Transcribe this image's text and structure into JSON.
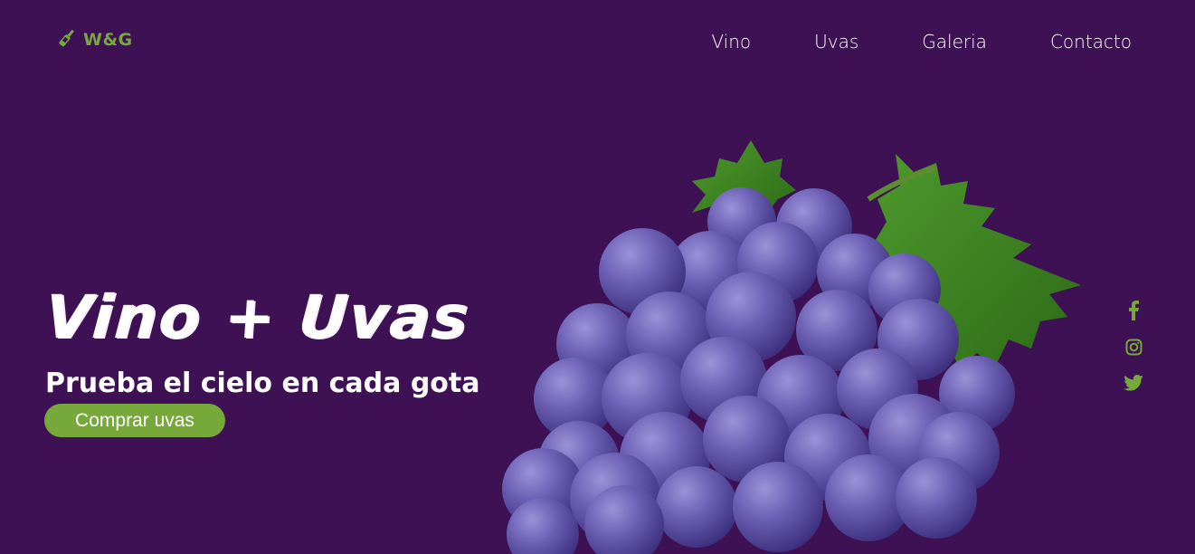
{
  "brand": {
    "logo_text": "W&G",
    "logo_icon": "wine-bottle-icon",
    "accent_color": "#76a83a"
  },
  "nav": {
    "items": [
      {
        "label": "Vino"
      },
      {
        "label": "Uvas"
      },
      {
        "label": "Galeria"
      },
      {
        "label": "Contacto"
      }
    ]
  },
  "hero": {
    "title": "Vino + Uvas",
    "subtitle": "Prueba el cielo en cada gota",
    "cta_label": "Comprar uvas",
    "image": "grape-bunch-with-leaves"
  },
  "social": {
    "icons": [
      "facebook-icon",
      "instagram-icon",
      "twitter-icon"
    ]
  },
  "colors": {
    "background": "#3e1155",
    "accent": "#76a83a",
    "text": "#ffffff"
  }
}
